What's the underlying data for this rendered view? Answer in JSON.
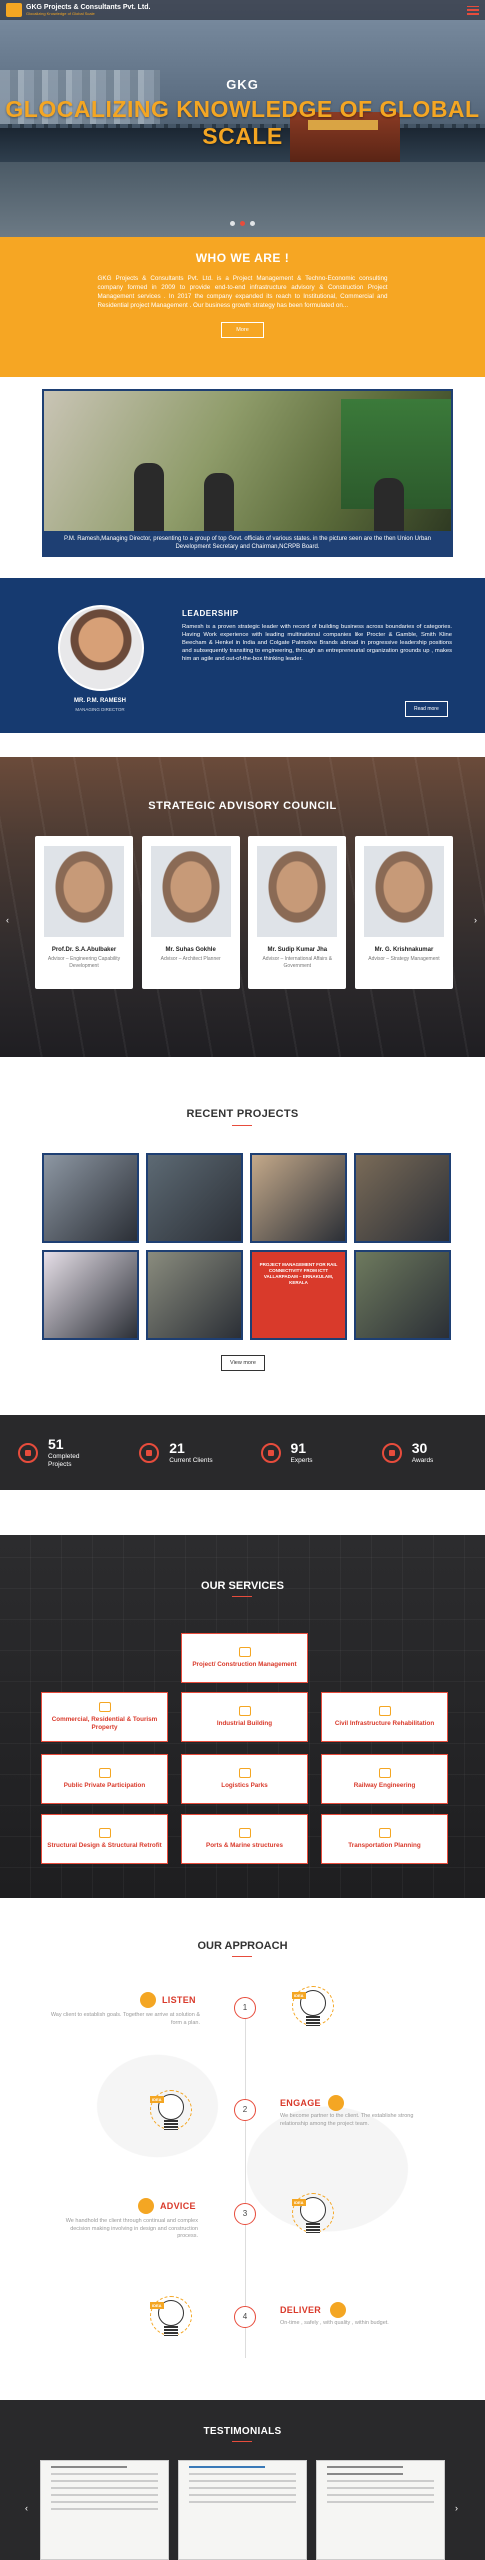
{
  "header": {
    "company_name": "GKG Projects & Consultants Pvt. Ltd.",
    "tagline": "Glocalizing Knowledge of Global Scale",
    "menu_icon": "hamburger-icon",
    "accent_color": "#e74c3c"
  },
  "hero": {
    "kicker": "GKG",
    "title": "GLOCALIZING KNOWLEDGE OF GLOBAL SCALE",
    "slides": 3,
    "active_slide": 2
  },
  "who": {
    "heading": "WHO WE ARE !",
    "body": "GKG Projects & Consultants Pvt. Ltd. is a Project Management & Techno-Economic consulting company formed in 2009 to provide end-to-end infrastructure advisory & Construction Project Management services . In 2017 the company expanded its reach to Institutional, Commercial and Residential project Management . Our business growth strategy has been formulated on...",
    "button": "More",
    "background": "#f6a623"
  },
  "photo": {
    "caption": "P.M. Ramesh,Managing Director, presenting to a group of top Govt. officials of various states. in the picture seen are the then Union Urban Development Secretary and Chairman,NCRPB Board."
  },
  "leadership": {
    "heading": "LEADERSHIP",
    "name": "MR. P.M. RAMESH",
    "role": "MANAGING DIRECTOR",
    "body": "Ramesh is a proven strategic leader with record of building business across boundaries of categories. Having Work experience with leading multinational companies like Procter & Gamble, Smith Kline Beecham & Henkel in India and Colgate Palmolive Brands abroad in progressive leadership positions and subsequently transiting to engineering, through an entrepreneurial organization grounds up , makes him an agile and out-of-the-box thinking leader.",
    "button": "Read more"
  },
  "council": {
    "heading": "STRATEGIC ADVISORY COUNCIL",
    "members": [
      {
        "name": "Prof.Dr. S.A.Abulbaker",
        "role": "Advisor – Engineering Capability Development"
      },
      {
        "name": "Mr. Suhas Gokhle",
        "role": "Advisor – Architect Planner"
      },
      {
        "name": "Mr. Sudip Kumar Jha",
        "role": "Advisor – International Affairs & Government"
      },
      {
        "name": "Mr. G. Krishnakumar",
        "role": "Advisor – Strategy Management"
      }
    ],
    "prev": "‹",
    "next": "›"
  },
  "recent": {
    "heading": "RECENT PROJECTS",
    "tiles": [
      {
        "name": "project-1",
        "color": "#8d97a3"
      },
      {
        "name": "project-2",
        "color": "#5d6a74"
      },
      {
        "name": "project-3",
        "color": "#c4a98a"
      },
      {
        "name": "project-4",
        "color": "#7a6b58"
      },
      {
        "name": "project-5",
        "color": "#e6dfe8"
      },
      {
        "name": "project-6",
        "color": "#8a8c7e"
      },
      {
        "name": "project-7",
        "color": "#d93a2b",
        "text": "PROJECT MANAGEMENT FOR RAIL CONNECTIVITY FROM ICTT VALLARPADAM – ERNAKULAM, KERALA"
      },
      {
        "name": "project-8",
        "color": "#6e7a5e"
      }
    ],
    "button": "View more"
  },
  "stats": [
    {
      "num": "51",
      "label": "Completed Projects",
      "icon": "briefcase-icon"
    },
    {
      "num": "21",
      "label": "Current Clients",
      "icon": "handshake-icon"
    },
    {
      "num": "91",
      "label": "Experts",
      "icon": "experts-icon"
    },
    {
      "num": "30",
      "label": "Awards",
      "icon": "trophy-icon"
    }
  ],
  "services": {
    "heading": "OUR SERVICES",
    "items": [
      "Project/ Construction Management",
      "Commercial, Residential & Tourism Property",
      "Industrial Building",
      "Civil Infrastructure Rehabilitation",
      "Public Private Participation",
      "Logistics Parks",
      "Railway Engineering",
      "Structural Design & Structural Retrofit",
      "Ports & Marine structures",
      "Transportation Planning"
    ]
  },
  "approach": {
    "heading": "OUR APPROACH",
    "idea_tag": "IDEA",
    "steps": [
      {
        "num": "1",
        "title": "LISTEN",
        "desc": "Way client to establish goals. Together we arrive at solution & form a plan."
      },
      {
        "num": "2",
        "title": "ENGAGE",
        "desc": "We become partner to the client. The establishe strong relationship among the project team."
      },
      {
        "num": "3",
        "title": "ADVICE",
        "desc": "We handhold the client through continual and complex decision making involving in design and construction process."
      },
      {
        "num": "4",
        "title": "DELIVER",
        "desc": "On-time , safely , with quality , within budget."
      }
    ]
  },
  "testimonials": {
    "heading": "TESTIMONIALS"
  }
}
